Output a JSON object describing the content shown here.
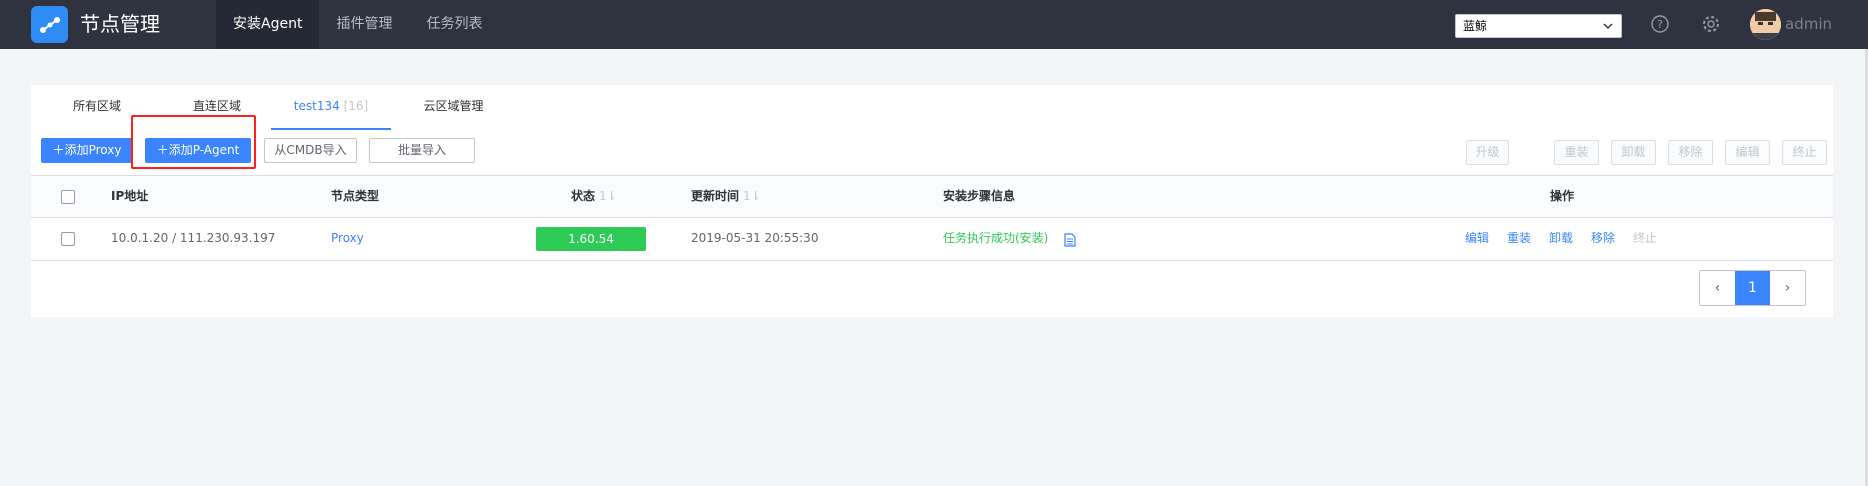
{
  "header": {
    "app_title": "节点管理",
    "nav": [
      "安装Agent",
      "插件管理",
      "任务列表"
    ],
    "region_value": "蓝鲸",
    "username": "admin"
  },
  "tabs": [
    {
      "label": "所有区域",
      "count": ""
    },
    {
      "label": "直连区域",
      "count": ""
    },
    {
      "label": "test134",
      "count": "[16]"
    },
    {
      "label": "云区域管理",
      "count": ""
    }
  ],
  "toolbar": {
    "add_proxy": "添加Proxy",
    "add_pagent": "添加P-Agent",
    "import_cmdb": "从CMDB导入",
    "batch_import": "批量导入",
    "right_actions": [
      "升级",
      "重装",
      "卸载",
      "移除",
      "编辑",
      "终止"
    ]
  },
  "table": {
    "columns": {
      "ip": "IP地址",
      "node_type": "节点类型",
      "status": "状态",
      "updated": "更新时间",
      "install_info": "安装步骤信息",
      "ops": "操作"
    },
    "sort_glyph": "1⇂",
    "rows": [
      {
        "ip": "10.0.1.20 / 111.230.93.197",
        "node_type": "Proxy",
        "status": "1.60.54",
        "updated": "2019-05-31 20:55:30",
        "install_info": "任务执行成功(安装)",
        "ops": [
          "编辑",
          "重装",
          "卸载",
          "移除",
          "终止"
        ]
      }
    ]
  },
  "pagination": {
    "prev": "‹",
    "current": "1",
    "next": "›"
  },
  "colors": {
    "primary": "#3a84ff",
    "success": "#2dcb56",
    "header_bg": "#2f3340",
    "highlight": "#ff1f1f"
  }
}
